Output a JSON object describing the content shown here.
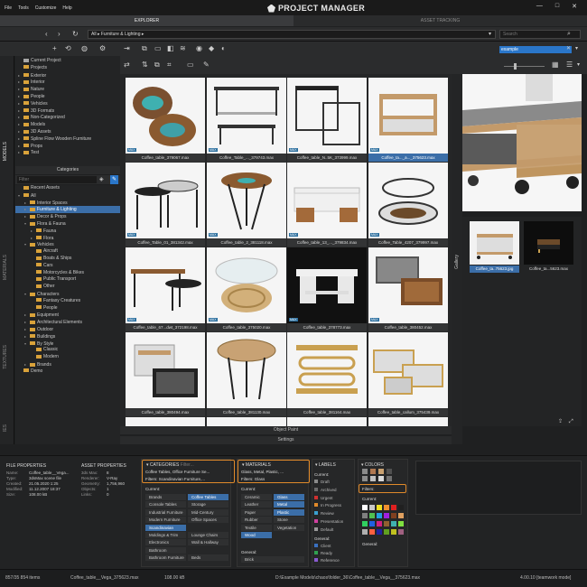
{
  "menu": {
    "items": [
      "File",
      "Tools",
      "Customize",
      "Help"
    ]
  },
  "app": {
    "title": "PROJECT MANAGER"
  },
  "tabs": {
    "explorer": "EXPLORER",
    "asset": "ASSET TRACKING"
  },
  "path": {
    "value": "All ▸  Furniture & Lighting ▸",
    "search_placeholder": "Search"
  },
  "toolbar": {
    "filter_value": "example"
  },
  "vtabs": {
    "models": "MODELS",
    "materials": "MATERIALS",
    "textures": "TEXTURES",
    "ies": "IES"
  },
  "tree1": [
    {
      "label": "Current Project",
      "arrow": "",
      "icon": "g"
    },
    {
      "label": "Projects",
      "arrow": "",
      "icon": "y"
    },
    {
      "label": "Exterior",
      "arrow": "▸",
      "icon": "y"
    },
    {
      "label": "Interior",
      "arrow": "▸",
      "icon": "y"
    },
    {
      "label": "Nature",
      "arrow": "▸",
      "icon": "y"
    },
    {
      "label": "People",
      "arrow": "▸",
      "icon": "y"
    },
    {
      "label": "Vehicles",
      "arrow": "▸",
      "icon": "y"
    },
    {
      "label": "3D Formats",
      "arrow": "▸",
      "icon": "y"
    },
    {
      "label": "Non-Categorized",
      "arrow": "▸",
      "icon": "y"
    },
    {
      "label": "Models",
      "arrow": "▸",
      "icon": "y"
    },
    {
      "label": "3D Assets",
      "arrow": "▸",
      "icon": "y"
    },
    {
      "label": "Spline Flow Wooden Furniture",
      "arrow": "▸",
      "icon": "y"
    },
    {
      "label": "Props",
      "arrow": "▸",
      "icon": "y"
    },
    {
      "label": "Test",
      "arrow": "▸",
      "icon": "y"
    }
  ],
  "categories": {
    "label": "Categories",
    "filter_placeholder": "Filter"
  },
  "tree2": [
    {
      "label": "Recent Assets",
      "indent": 0,
      "arrow": "",
      "sel": false
    },
    {
      "label": "All",
      "indent": 0,
      "arrow": "▾",
      "sel": false
    },
    {
      "label": "Interior Spaces",
      "indent": 1,
      "arrow": "▸",
      "sel": false
    },
    {
      "label": "Furniture & Lighting",
      "indent": 1,
      "arrow": "▸",
      "sel": true
    },
    {
      "label": "Decor & Props",
      "indent": 1,
      "arrow": "▸",
      "sel": false
    },
    {
      "label": "Flora & Fauna",
      "indent": 1,
      "arrow": "▾",
      "sel": false
    },
    {
      "label": "Fauna",
      "indent": 2,
      "arrow": "▸",
      "sel": false
    },
    {
      "label": "Flora",
      "indent": 2,
      "arrow": "▸",
      "sel": false
    },
    {
      "label": "Vehicles",
      "indent": 1,
      "arrow": "▾",
      "sel": false
    },
    {
      "label": "Aircraft",
      "indent": 2,
      "arrow": "",
      "sel": false
    },
    {
      "label": "Boats & Ships",
      "indent": 2,
      "arrow": "",
      "sel": false
    },
    {
      "label": "Cars",
      "indent": 2,
      "arrow": "",
      "sel": false
    },
    {
      "label": "Motorcycles & Bikes",
      "indent": 2,
      "arrow": "",
      "sel": false
    },
    {
      "label": "Public Transport",
      "indent": 2,
      "arrow": "",
      "sel": false
    },
    {
      "label": "Other",
      "indent": 2,
      "arrow": "",
      "sel": false
    },
    {
      "label": "Characters",
      "indent": 1,
      "arrow": "▾",
      "sel": false
    },
    {
      "label": "Fantasy Creatures",
      "indent": 2,
      "arrow": "",
      "sel": false
    },
    {
      "label": "People",
      "indent": 2,
      "arrow": "",
      "sel": false
    },
    {
      "label": "Equipment",
      "indent": 1,
      "arrow": "▸",
      "sel": false
    },
    {
      "label": "Architectural Elements",
      "indent": 1,
      "arrow": "▸",
      "sel": false
    },
    {
      "label": "Outdoor",
      "indent": 1,
      "arrow": "▸",
      "sel": false
    },
    {
      "label": "Buildings",
      "indent": 1,
      "arrow": "▸",
      "sel": false
    },
    {
      "label": "By Style",
      "indent": 1,
      "arrow": "▾",
      "sel": false
    },
    {
      "label": "Classic",
      "indent": 2,
      "arrow": "",
      "sel": false
    },
    {
      "label": "Modern",
      "indent": 2,
      "arrow": "",
      "sel": false
    },
    {
      "label": "Brands",
      "indent": 1,
      "arrow": "▸",
      "sel": false
    },
    {
      "label": "Demo",
      "indent": 0,
      "arrow": "",
      "sel": false
    }
  ],
  "grid": [
    "Coffee_table_379067.max",
    "Coffee_Table_..._379743.max",
    "Coffee_table_N..5K_373999.max",
    "Coffee_ta..._a..._375623.max",
    "Coffee_Table_01_381342.max",
    "Coffee_table_2_381118.max",
    "Coffee_table_13_..._379834.max",
    "Coffee_Table_4207_379997.max",
    "Coffee_table_67...dwt_372198.max",
    "Coffee_table_375020.max",
    "Coffee_table_378773.max",
    "Coffee_table_380452.max",
    "Coffee_table_380494.max",
    "Coffee_table_381130.max",
    "Coffee_table_381164.max",
    "Coffee_table_callum_375439.max"
  ],
  "grid_extra": "...",
  "obj_bar": "Object Paint",
  "settings_bar": "Settings",
  "gallery": {
    "tab": "Gallery",
    "items": [
      "Coffee_ta..75623.jpg",
      "Coffee_ta...5623.max"
    ]
  },
  "file_props": {
    "title": "FILE PROPERTIES",
    "keys": [
      "Name:",
      "Type:",
      "Created:",
      "Modified:",
      "Size:"
    ],
    "values": [
      "Coffee_table__Vega...",
      "3dsMax scene file",
      "21.05.2020 1:25",
      "11.12.2007 18:37",
      "108.00 kB"
    ]
  },
  "asset_props": {
    "title": "ASSET PROPERTIES",
    "keys": [
      "3ds Max:",
      "Renderer:",
      "Geometry:",
      "Objects:",
      "Links:"
    ],
    "values": [
      "8",
      "V-Ray",
      "1,756,960",
      "1",
      "0"
    ]
  },
  "categories_panel": {
    "title": "CATEGORIES",
    "filter_placeholder": "Filter...",
    "value": "Coffee Tables, Office Furniture Se...",
    "filters_value": "Filters: Scandinavian Furniture,...",
    "current_label": "Current:",
    "chips": [
      [
        "Brands",
        false
      ],
      [
        "Coffee Tables",
        true
      ],
      [
        "Console Tables",
        false
      ],
      [
        "Storage",
        false
      ],
      [
        "Industrial Furniture",
        false
      ],
      [
        "Mid-Century",
        false
      ],
      [
        "Modern Furniture",
        false
      ],
      [
        "Office Spaces",
        false
      ],
      [
        "Scandinavian Furniture",
        true
      ],
      [
        "",
        false
      ],
      [
        "Moldings & Trim",
        false
      ],
      [
        "Lounge Chairs",
        false
      ],
      [
        "Electronics",
        false
      ],
      [
        "Wall & Hallway",
        false
      ],
      [
        "Bathroom Accessories",
        false
      ],
      [
        "",
        false
      ],
      [
        "Bathroom Furniture",
        false
      ],
      [
        "Beds",
        false
      ]
    ]
  },
  "materials_panel": {
    "title": "MATERIALS",
    "value": "Glass, Metal, Plastic, ...",
    "filters_value": "Filters: Glass",
    "current_label": "Current:",
    "chips": [
      [
        "Ceramic",
        false
      ],
      [
        "Glass",
        true
      ],
      [
        "Leather",
        false
      ],
      [
        "Metal",
        true
      ],
      [
        "Paper",
        false
      ],
      [
        "Plastic",
        true
      ],
      [
        "Rubber",
        false
      ],
      [
        "Stone",
        false
      ],
      [
        "Textile",
        false
      ],
      [
        "Vegetation",
        false
      ],
      [
        "Wood",
        true
      ],
      [
        "",
        false
      ]
    ],
    "general_label": "General:",
    "general": [
      "Brick"
    ]
  },
  "labels_panel": {
    "title": "LABELS",
    "current_label": "Current:",
    "items": [
      "Draft",
      "Archived",
      "Urgent",
      "In Progress",
      "Review",
      "Presentation",
      "Default"
    ],
    "colors": [
      "#8a8a8a",
      "#6b6b6b",
      "#d03030",
      "#e08a2a",
      "#3aa0d0",
      "#d040a0",
      "#9a9a9a"
    ],
    "general_label": "General:",
    "general": [
      "Client",
      "Ready",
      "Reference"
    ],
    "general_colors": [
      "#3a70c0",
      "#30a050",
      "#8a5ad0"
    ]
  },
  "colors_panel": {
    "title": "COLORS",
    "filters_value": "Filters:",
    "current_label": "Current:",
    "general_label": "General:",
    "top": [
      "#8a8a8a",
      "#b07850",
      "#c8a070",
      "#505050",
      "#8c8c8c",
      "#c0c0c0",
      "#d8d8d8",
      "#707070"
    ],
    "grid": [
      "#ffffff",
      "#c8c8c8",
      "#f0e020",
      "#f09030",
      "#e02020",
      "#202020",
      "#808080",
      "#50c050",
      "#20a0e0",
      "#a020e0",
      "#804020",
      "#e0a060",
      "#30d060",
      "#2060e0",
      "#d02080",
      "#906030",
      "#40b0b0",
      "#80e040",
      "#b0b0b0",
      "#ff6040",
      "#2020a0",
      "#60a020",
      "#c0c020",
      "#a06080"
    ]
  },
  "status": {
    "items": "857/35 854 items",
    "file": "Coffee_table__Vega_375623.max",
    "size": "108.00 kB",
    "path": "D:\\Example Models\\chaos\\folder_36\\Coffee_table__Vega__375623.max",
    "version": "4.00.10 [teamwork mode]"
  }
}
